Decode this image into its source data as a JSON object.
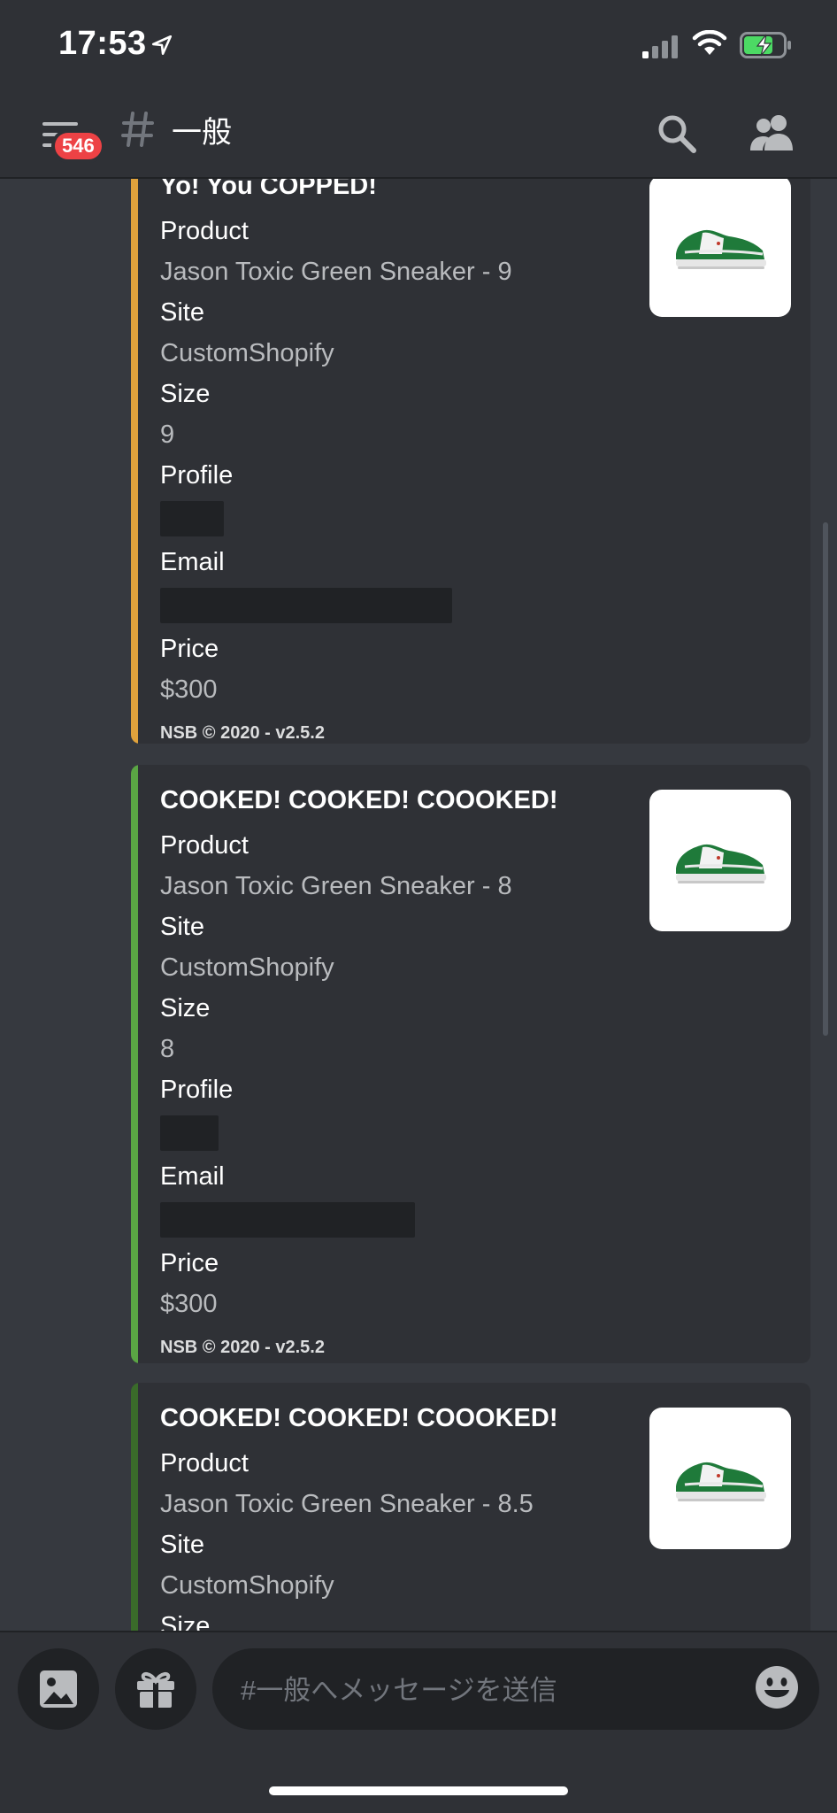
{
  "status_bar": {
    "time": "17:53"
  },
  "header": {
    "badge_count": "546",
    "channel_name": "一般"
  },
  "embeds": [
    {
      "title": "Yo! You COPPED!",
      "accent": "#e0a23c",
      "fields": [
        {
          "name": "Product",
          "value": "Jason Toxic Green Sneaker - 9"
        },
        {
          "name": "Site",
          "value": "CustomShopify"
        },
        {
          "name": "Size",
          "value": "9"
        },
        {
          "name": "Profile",
          "value": ""
        },
        {
          "name": "Email",
          "value": ""
        },
        {
          "name": "Price",
          "value": "$300"
        }
      ],
      "footer": "NSB © 2020 - v2.5.2"
    },
    {
      "title": "COOKED! COOKED! COOOKED!",
      "accent": "#5aa544",
      "fields": [
        {
          "name": "Product",
          "value": "Jason Toxic Green Sneaker - 8"
        },
        {
          "name": "Site",
          "value": "CustomShopify"
        },
        {
          "name": "Size",
          "value": "8"
        },
        {
          "name": "Profile",
          "value": ""
        },
        {
          "name": "Email",
          "value": ""
        },
        {
          "name": "Price",
          "value": "$300"
        }
      ],
      "footer": "NSB © 2020 - v2.5.2"
    },
    {
      "title": "COOKED! COOKED! COOOKED!",
      "accent": "#3a6b2a",
      "fields": [
        {
          "name": "Product",
          "value": "Jason Toxic Green Sneaker - 8.5"
        },
        {
          "name": "Site",
          "value": "CustomShopify"
        },
        {
          "name": "Size",
          "value": ""
        }
      ]
    }
  ],
  "composer": {
    "placeholder": "#一般へメッセージを送信"
  },
  "colors": {
    "background": "#36393f",
    "panel": "#2f3136",
    "dark": "#202225",
    "badge": "#ed4245"
  }
}
